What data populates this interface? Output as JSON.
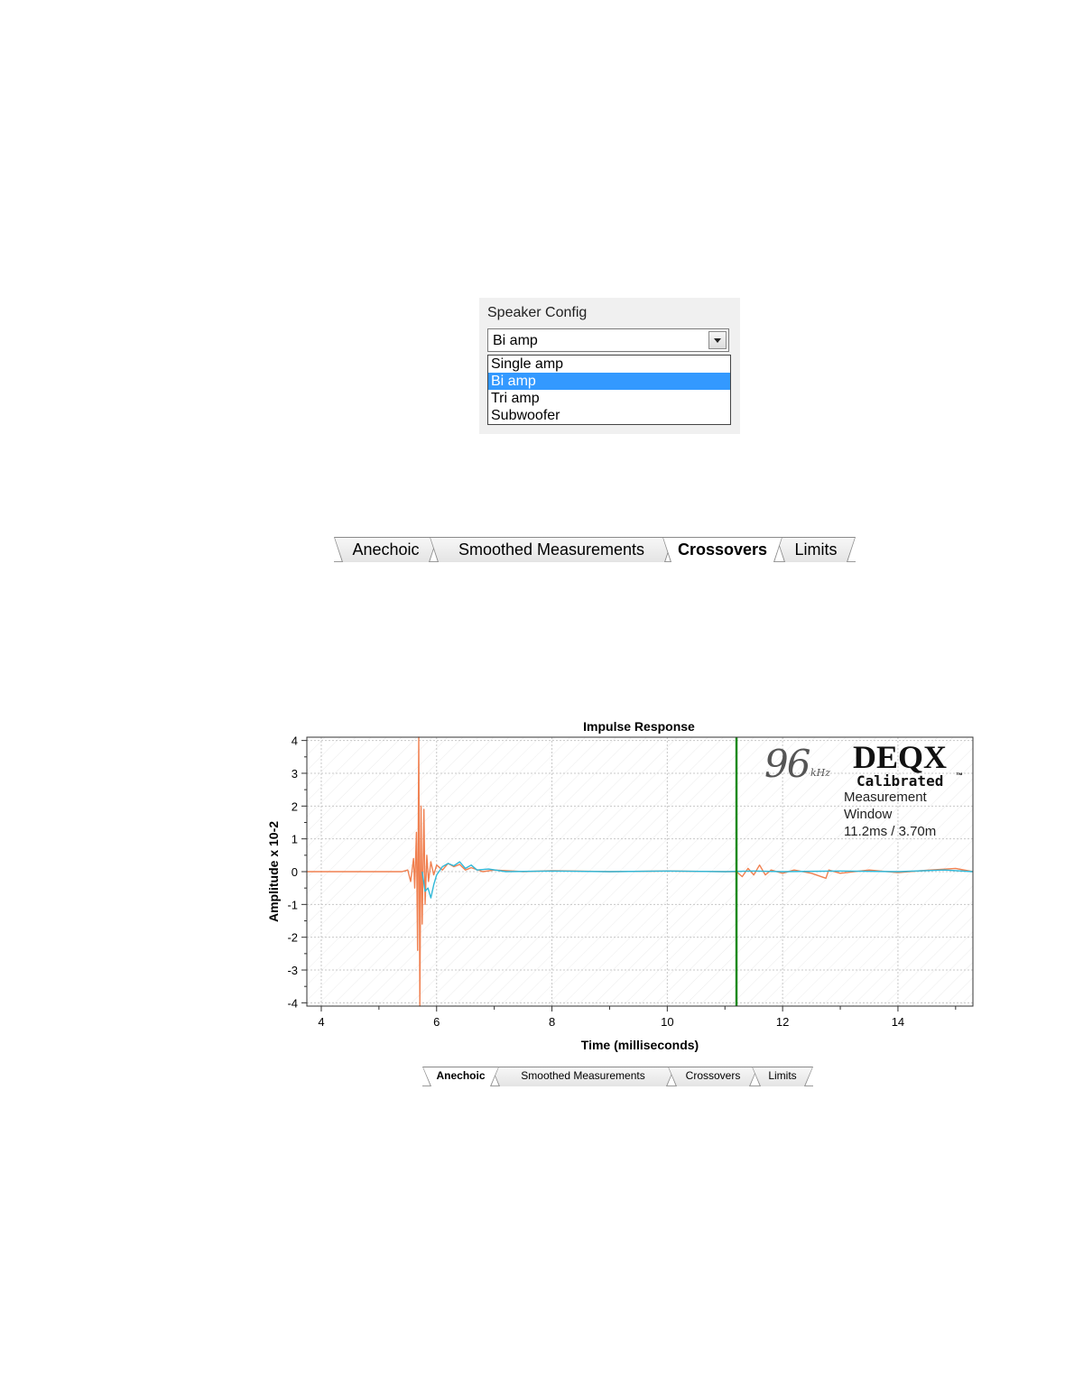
{
  "speaker_config": {
    "label": "Speaker Config",
    "selected": "Bi amp",
    "options": [
      "Single amp",
      "Bi amp",
      "Tri amp",
      "Subwoofer"
    ]
  },
  "tabs_top": {
    "items": [
      "Anechoic",
      "Smoothed Measurements",
      "Crossovers",
      "Limits"
    ],
    "active": "Crossovers"
  },
  "tabs_bottom": {
    "items": [
      "Anechoic",
      "Smoothed Measurements",
      "Crossovers",
      "Limits"
    ],
    "active": "Anechoic"
  },
  "logo": {
    "rate": "96",
    "unit": "kHz",
    "brand": "DEQX",
    "tagline": "Calibrated",
    "tm": "™"
  },
  "window_note": {
    "line1": "Measurement",
    "line2": "Window",
    "line3": "11.2ms / 3.70m"
  },
  "colors": {
    "series_orange": "#f08050",
    "series_cyan": "#30b8d8",
    "window_marker": "#1e8a1e",
    "selection": "#3399ff"
  },
  "chart_data": {
    "type": "line",
    "title": "Impulse Response",
    "xlabel": "Time (milliseconds)",
    "ylabel": "Amplitude x 10-2",
    "xlim": [
      3.75,
      15.3
    ],
    "ylim": [
      -4.1,
      4.1
    ],
    "x_ticks": [
      4,
      6,
      8,
      10,
      12,
      14
    ],
    "y_ticks": [
      4,
      3,
      2,
      1,
      0,
      -1,
      -2,
      -3,
      -4
    ],
    "grid": true,
    "marker_x": 11.2,
    "series": [
      {
        "color": "#f08050",
        "points": [
          [
            3.75,
            0
          ],
          [
            5.4,
            0
          ],
          [
            5.5,
            0.05
          ],
          [
            5.55,
            -0.3
          ],
          [
            5.6,
            0.4
          ],
          [
            5.62,
            -0.5
          ],
          [
            5.65,
            1.2
          ],
          [
            5.67,
            -2.4
          ],
          [
            5.69,
            4.1
          ],
          [
            5.71,
            -4.1
          ],
          [
            5.73,
            2.0
          ],
          [
            5.75,
            -1.6
          ],
          [
            5.78,
            1.9
          ],
          [
            5.8,
            -1.0
          ],
          [
            5.83,
            0.5
          ],
          [
            5.86,
            -0.3
          ],
          [
            5.9,
            0.3
          ],
          [
            5.95,
            -0.1
          ],
          [
            6.0,
            0.2
          ],
          [
            6.1,
            0.05
          ],
          [
            6.2,
            0.25
          ],
          [
            6.3,
            0.15
          ],
          [
            6.4,
            0.22
          ],
          [
            6.5,
            0.05
          ],
          [
            6.6,
            0.12
          ],
          [
            6.8,
            0.0
          ],
          [
            7.0,
            0.05
          ],
          [
            7.5,
            0.0
          ],
          [
            8.0,
            0.03
          ],
          [
            9.0,
            0.0
          ],
          [
            10.0,
            0.02
          ],
          [
            11.0,
            0.0
          ],
          [
            11.2,
            0.0
          ],
          [
            11.3,
            -0.15
          ],
          [
            11.4,
            0.1
          ],
          [
            11.5,
            -0.1
          ],
          [
            11.6,
            0.2
          ],
          [
            11.7,
            -0.1
          ],
          [
            11.8,
            0.05
          ],
          [
            12.0,
            -0.05
          ],
          [
            12.2,
            0.05
          ],
          [
            12.5,
            -0.05
          ],
          [
            12.75,
            -0.2
          ],
          [
            12.8,
            0.05
          ],
          [
            13.0,
            -0.05
          ],
          [
            13.5,
            0.05
          ],
          [
            14.0,
            -0.03
          ],
          [
            14.5,
            0.04
          ],
          [
            15.0,
            0.1
          ],
          [
            15.3,
            0.0
          ]
        ]
      },
      {
        "color": "#30b8d8",
        "points": [
          [
            5.75,
            0
          ],
          [
            5.8,
            -0.6
          ],
          [
            5.85,
            -0.5
          ],
          [
            5.9,
            -0.8
          ],
          [
            5.95,
            -0.4
          ],
          [
            6.0,
            -0.1
          ],
          [
            6.1,
            0.15
          ],
          [
            6.2,
            0.25
          ],
          [
            6.3,
            0.18
          ],
          [
            6.4,
            0.3
          ],
          [
            6.5,
            0.1
          ],
          [
            6.6,
            0.2
          ],
          [
            6.7,
            0.05
          ],
          [
            6.9,
            0.08
          ],
          [
            7.2,
            0.0
          ],
          [
            8.0,
            0.02
          ],
          [
            9.0,
            0.0
          ],
          [
            10.0,
            0.02
          ],
          [
            11.0,
            0.0
          ],
          [
            11.5,
            0.02
          ],
          [
            12.0,
            0.0
          ],
          [
            13.0,
            0.02
          ],
          [
            14.0,
            0.0
          ],
          [
            14.8,
            0.05
          ],
          [
            15.3,
            0.0
          ]
        ]
      }
    ]
  }
}
